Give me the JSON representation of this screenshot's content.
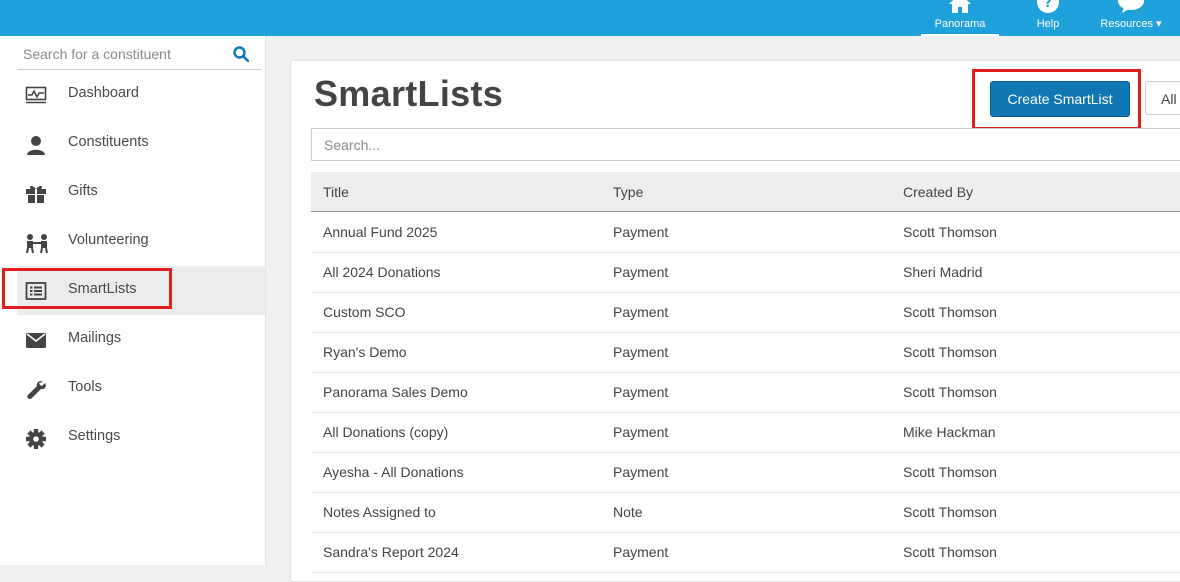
{
  "topnav": {
    "items": [
      {
        "label": "Panorama",
        "icon": "home-icon"
      },
      {
        "label": "Help",
        "icon": "help-icon"
      },
      {
        "label": "Resources ▾",
        "icon": "speech-bubble-icon"
      }
    ]
  },
  "sidebar": {
    "search_placeholder": "Search for a constituent",
    "items": [
      {
        "label": "Dashboard",
        "icon": "dashboard-icon"
      },
      {
        "label": "Constituents",
        "icon": "person-icon"
      },
      {
        "label": "Gifts",
        "icon": "gift-icon"
      },
      {
        "label": "Volunteering",
        "icon": "volunteers-icon"
      },
      {
        "label": "SmartLists",
        "icon": "list-icon"
      },
      {
        "label": "Mailings",
        "icon": "envelope-icon"
      },
      {
        "label": "Tools",
        "icon": "wrench-icon"
      },
      {
        "label": "Settings",
        "icon": "gear-icon"
      }
    ],
    "active": "SmartLists"
  },
  "main": {
    "title": "SmartLists",
    "create_label": "Create SmartList",
    "all_label": "All",
    "search_placeholder": "Search...",
    "columns": [
      "Title",
      "Type",
      "Created By"
    ],
    "rows": [
      [
        "Annual Fund 2025",
        "Payment",
        "Scott Thomson"
      ],
      [
        "All 2024 Donations",
        "Payment",
        "Sheri Madrid"
      ],
      [
        "Custom SCO",
        "Payment",
        "Scott Thomson"
      ],
      [
        "Ryan's Demo",
        "Payment",
        "Scott Thomson"
      ],
      [
        "Panorama Sales Demo",
        "Payment",
        "Scott Thomson"
      ],
      [
        "All Donations (copy)",
        "Payment",
        "Mike Hackman"
      ],
      [
        "Ayesha - All Donations",
        "Payment",
        "Scott Thomson"
      ],
      [
        "Notes Assigned to",
        "Note",
        "Scott Thomson"
      ],
      [
        "Sandra's Report 2024",
        "Payment",
        "Scott Thomson"
      ]
    ]
  },
  "colors": {
    "topbar": "#1fa2dc",
    "primary_button": "#0e77b4",
    "highlight": "#e02020"
  }
}
